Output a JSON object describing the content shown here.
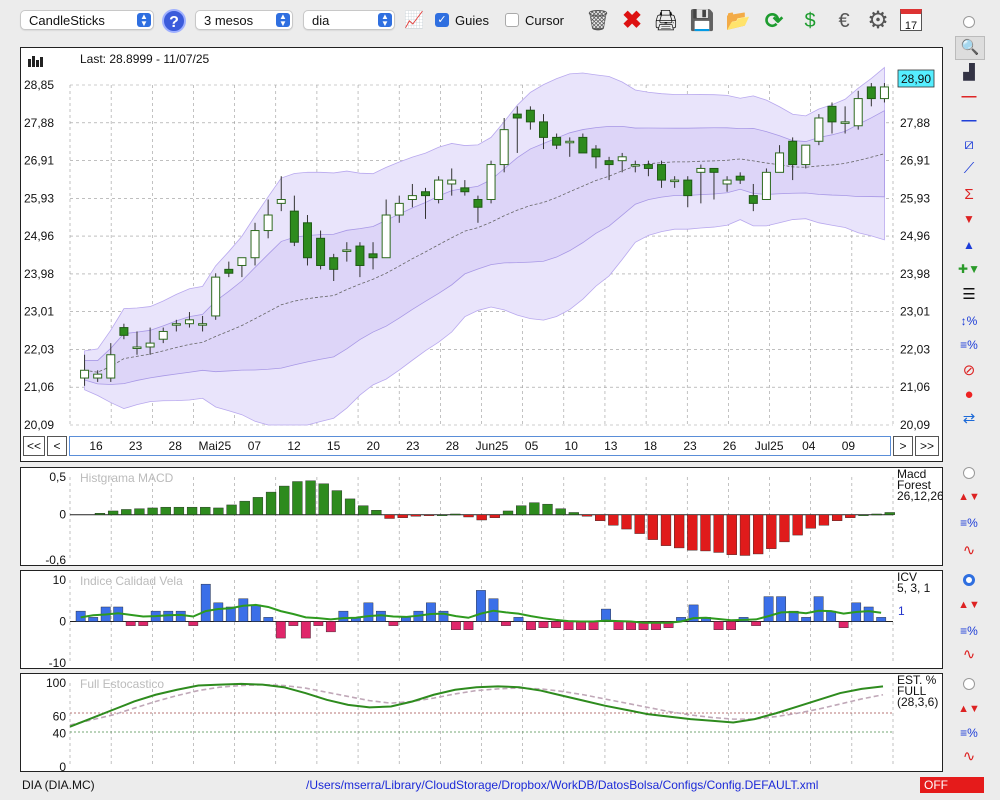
{
  "toolbar": {
    "chart_type": "CandleSticks",
    "period": "3 mesos",
    "interval": "dia",
    "guides_label": "Guies",
    "cursor_label": "Cursor",
    "guides_checked": true,
    "cursor_checked": false,
    "calendar_day": "17"
  },
  "price_panel": {
    "last": "Last: 28.8999 - 11/07/25",
    "y_labels": [
      "28,85",
      "27,88",
      "26,91",
      "25,93",
      "24,96",
      "23,98",
      "23,01",
      "22,03",
      "21,06",
      "20,09"
    ],
    "right_labels": [
      "27,88",
      "26,91",
      "25,93",
      "24,96",
      "23,98",
      "23,01",
      "22,03",
      "21,06",
      "20,09"
    ],
    "current_price": "28,90",
    "current_price_color": "#55eeff"
  },
  "timeline": {
    "prev_fast": "<<",
    "prev": "<",
    "next": ">",
    "next_fast": ">>",
    "labels": [
      "16",
      "23",
      "28",
      "Mai25",
      "07",
      "12",
      "15",
      "20",
      "23",
      "28",
      "Jun25",
      "05",
      "10",
      "13",
      "18",
      "23",
      "26",
      "Jul25",
      "04",
      "09"
    ]
  },
  "macd_panel": {
    "title": "Histgrama MACD",
    "y_labels": [
      "0,5",
      "0",
      "-0,6"
    ],
    "legend": [
      "Macd",
      "Forest",
      "26,12,26"
    ]
  },
  "icv_panel": {
    "title": "Indice Calidad Vela",
    "y_labels": [
      "10",
      "0",
      "-10"
    ],
    "legend": [
      "ICV",
      "5, 3, 1"
    ],
    "value": "1"
  },
  "stoch_panel": {
    "title": "Full Estocastico",
    "y_labels": [
      "100",
      "60",
      "40",
      "0"
    ],
    "legend": [
      "EST. %",
      "FULL",
      "(28,3,6)"
    ]
  },
  "status": {
    "symbol": "DIA (DIA.MC)",
    "path": "/Users/mserra/Library/CloudStorage/Dropbox/WorkDB/DatosBolsa/Configs/Config.DEFAULT.xml",
    "mode": "OFF"
  },
  "colors": {
    "up": "#2e8b1e",
    "down": "#ffffff",
    "macd_pos": "#2e8b1e",
    "macd_neg": "#e01b1b",
    "icv_pos": "#3b6fe8",
    "icv_neg": "#e0266a",
    "band_fill": "#e6e0fa"
  },
  "chart_data": [
    {
      "type": "candlestick",
      "title": "",
      "ylim": [
        20.09,
        28.85
      ],
      "candles": [
        {
          "o": 21.3,
          "h": 21.9,
          "l": 21.1,
          "c": 21.5
        },
        {
          "o": 21.3,
          "h": 21.5,
          "l": 21.2,
          "c": 21.4
        },
        {
          "o": 21.3,
          "h": 22.2,
          "l": 21.2,
          "c": 21.9
        },
        {
          "o": 22.6,
          "h": 22.7,
          "l": 22.3,
          "c": 22.4
        },
        {
          "o": 22.1,
          "h": 22.5,
          "l": 21.9,
          "c": 22.1
        },
        {
          "o": 22.1,
          "h": 22.6,
          "l": 21.9,
          "c": 22.2
        },
        {
          "o": 22.3,
          "h": 22.6,
          "l": 22.2,
          "c": 22.5
        },
        {
          "o": 22.7,
          "h": 22.8,
          "l": 22.5,
          "c": 22.7
        },
        {
          "o": 22.7,
          "h": 23.0,
          "l": 22.6,
          "c": 22.8
        },
        {
          "o": 22.7,
          "h": 22.9,
          "l": 22.5,
          "c": 22.7
        },
        {
          "o": 22.9,
          "h": 24.0,
          "l": 22.8,
          "c": 23.9
        },
        {
          "o": 24.1,
          "h": 24.3,
          "l": 23.9,
          "c": 24.0
        },
        {
          "o": 24.2,
          "h": 24.4,
          "l": 23.9,
          "c": 24.4
        },
        {
          "o": 24.4,
          "h": 25.3,
          "l": 24.2,
          "c": 25.1
        },
        {
          "o": 25.1,
          "h": 25.9,
          "l": 24.9,
          "c": 25.5
        },
        {
          "o": 25.8,
          "h": 26.5,
          "l": 25.6,
          "c": 25.9
        },
        {
          "o": 25.6,
          "h": 26.0,
          "l": 24.7,
          "c": 24.8
        },
        {
          "o": 25.3,
          "h": 25.5,
          "l": 24.2,
          "c": 24.4
        },
        {
          "o": 24.9,
          "h": 25.1,
          "l": 24.1,
          "c": 24.2
        },
        {
          "o": 24.4,
          "h": 24.5,
          "l": 23.8,
          "c": 24.1
        },
        {
          "o": 24.6,
          "h": 24.8,
          "l": 24.3,
          "c": 24.6
        },
        {
          "o": 24.7,
          "h": 24.8,
          "l": 23.9,
          "c": 24.2
        },
        {
          "o": 24.5,
          "h": 24.8,
          "l": 24.1,
          "c": 24.4
        },
        {
          "o": 24.4,
          "h": 25.9,
          "l": 24.4,
          "c": 25.5
        },
        {
          "o": 25.5,
          "h": 26.0,
          "l": 25.3,
          "c": 25.8
        },
        {
          "o": 25.9,
          "h": 26.3,
          "l": 25.7,
          "c": 26.0
        },
        {
          "o": 26.1,
          "h": 26.2,
          "l": 25.4,
          "c": 26.0
        },
        {
          "o": 25.9,
          "h": 26.5,
          "l": 25.8,
          "c": 26.4
        },
        {
          "o": 26.3,
          "h": 26.7,
          "l": 26.0,
          "c": 26.4
        },
        {
          "o": 26.2,
          "h": 26.4,
          "l": 26.0,
          "c": 26.1
        },
        {
          "o": 25.9,
          "h": 26.0,
          "l": 25.3,
          "c": 25.7
        },
        {
          "o": 25.9,
          "h": 26.9,
          "l": 25.8,
          "c": 26.8
        },
        {
          "o": 26.8,
          "h": 28.0,
          "l": 26.6,
          "c": 27.7
        },
        {
          "o": 28.1,
          "h": 28.3,
          "l": 27.1,
          "c": 28.0
        },
        {
          "o": 28.2,
          "h": 28.3,
          "l": 27.7,
          "c": 27.9
        },
        {
          "o": 27.9,
          "h": 28.1,
          "l": 27.2,
          "c": 27.5
        },
        {
          "o": 27.5,
          "h": 27.6,
          "l": 27.2,
          "c": 27.3
        },
        {
          "o": 27.4,
          "h": 27.5,
          "l": 27.0,
          "c": 27.4
        },
        {
          "o": 27.5,
          "h": 27.6,
          "l": 27.1,
          "c": 27.1
        },
        {
          "o": 27.2,
          "h": 27.3,
          "l": 26.7,
          "c": 27.0
        },
        {
          "o": 26.9,
          "h": 27.0,
          "l": 26.4,
          "c": 26.8
        },
        {
          "o": 26.9,
          "h": 27.1,
          "l": 26.6,
          "c": 27.0
        },
        {
          "o": 26.8,
          "h": 26.9,
          "l": 26.6,
          "c": 26.8
        },
        {
          "o": 26.8,
          "h": 26.9,
          "l": 26.5,
          "c": 26.7
        },
        {
          "o": 26.8,
          "h": 26.9,
          "l": 26.2,
          "c": 26.4
        },
        {
          "o": 26.4,
          "h": 26.5,
          "l": 26.2,
          "c": 26.4
        },
        {
          "o": 26.4,
          "h": 26.5,
          "l": 25.7,
          "c": 26.0
        },
        {
          "o": 26.6,
          "h": 26.8,
          "l": 25.8,
          "c": 26.7
        },
        {
          "o": 26.7,
          "h": 26.7,
          "l": 25.9,
          "c": 26.6
        },
        {
          "o": 26.3,
          "h": 26.5,
          "l": 26.1,
          "c": 26.4
        },
        {
          "o": 26.5,
          "h": 26.6,
          "l": 26.3,
          "c": 26.4
        },
        {
          "o": 26.0,
          "h": 26.3,
          "l": 25.6,
          "c": 25.8
        },
        {
          "o": 25.9,
          "h": 26.7,
          "l": 25.9,
          "c": 26.6
        },
        {
          "o": 26.6,
          "h": 27.3,
          "l": 26.6,
          "c": 27.1
        },
        {
          "o": 27.4,
          "h": 27.5,
          "l": 26.4,
          "c": 26.8
        },
        {
          "o": 26.8,
          "h": 27.3,
          "l": 26.7,
          "c": 27.3
        },
        {
          "o": 27.4,
          "h": 28.1,
          "l": 27.3,
          "c": 28.0
        },
        {
          "o": 28.3,
          "h": 28.4,
          "l": 27.6,
          "c": 27.9
        },
        {
          "o": 27.9,
          "h": 28.3,
          "l": 27.6,
          "c": 27.9
        },
        {
          "o": 27.8,
          "h": 28.7,
          "l": 27.7,
          "c": 28.5
        },
        {
          "o": 28.8,
          "h": 28.9,
          "l": 28.3,
          "c": 28.5
        },
        {
          "o": 28.5,
          "h": 28.9,
          "l": 28.4,
          "c": 28.8
        }
      ]
    },
    {
      "type": "bar",
      "title": "Histgrama MACD",
      "ylim": [
        -0.6,
        0.5
      ],
      "values": [
        0.02,
        0.05,
        0.07,
        0.08,
        0.09,
        0.1,
        0.1,
        0.1,
        0.1,
        0.09,
        0.13,
        0.18,
        0.23,
        0.3,
        0.38,
        0.44,
        0.45,
        0.41,
        0.32,
        0.21,
        0.12,
        0.06,
        -0.05,
        -0.04,
        -0.02,
        -0.01,
        0.0,
        0.01,
        -0.03,
        -0.07,
        -0.04,
        0.05,
        0.12,
        0.16,
        0.14,
        0.08,
        0.03,
        -0.02,
        -0.08,
        -0.14,
        -0.19,
        -0.25,
        -0.33,
        -0.41,
        -0.44,
        -0.47,
        -0.48,
        -0.5,
        -0.53,
        -0.54,
        -0.52,
        -0.45,
        -0.36,
        -0.27,
        -0.18,
        -0.14,
        -0.08,
        -0.04,
        0.0,
        0.01,
        0.03
      ]
    },
    {
      "type": "bar",
      "title": "Indice Calidad Vela",
      "ylim": [
        -10,
        10
      ],
      "values": [
        2.5,
        1,
        3.5,
        3.5,
        -1,
        -1,
        2.5,
        2.5,
        2.5,
        -1,
        9,
        4.5,
        3.5,
        5.5,
        4,
        1,
        -4,
        -1,
        -4,
        -1,
        -2.5,
        2.5,
        1,
        4.5,
        2.5,
        -1,
        1,
        2.5,
        4.5,
        2.5,
        -2,
        -2,
        7.5,
        5.5,
        -1,
        1,
        -2,
        -1.5,
        -1.5,
        -2,
        -2,
        -2,
        3,
        -2,
        -2,
        -2,
        -2,
        -1.5,
        1,
        4,
        1,
        -2,
        -2,
        1,
        -1,
        6,
        6,
        2.5,
        1,
        6,
        2.5,
        -1.5,
        4.5,
        3.5,
        1
      ],
      "signal": [
        1,
        1.5,
        1.7,
        2,
        1.6,
        1.2,
        1.3,
        1.5,
        1.6,
        1.2,
        2.5,
        3,
        3.2,
        3.8,
        4,
        3.5,
        2.5,
        1.8,
        1,
        0.8,
        0.5,
        0.8,
        0.9,
        1.3,
        1.5,
        1.2,
        1.1,
        1.4,
        1.8,
        1.9,
        1.3,
        0.9,
        1.9,
        2.6,
        2.2,
        1.9,
        1.3,
        0.8,
        0.4,
        0.1,
        0,
        0,
        0.2,
        0.1,
        0,
        -0.3,
        -0.3,
        -0.3,
        0,
        0.8,
        0.9,
        0.6,
        0.3,
        0.4,
        0.5,
        1.3,
        2.2,
        2.3,
        2,
        2.6,
        2.5,
        1.9,
        2.3,
        2.5,
        2.1
      ]
    },
    {
      "type": "line",
      "title": "Full Estocastico",
      "ylim": [
        0,
        100
      ],
      "series": [
        {
          "values": [
            48,
            58,
            68,
            78,
            86,
            92,
            97,
            98,
            99,
            98,
            95,
            88,
            80,
            74,
            71,
            72,
            78,
            86,
            92,
            95,
            96,
            95,
            91,
            85,
            79,
            73,
            68,
            63,
            60,
            57,
            55,
            53,
            57,
            64,
            72,
            80,
            88,
            93,
            96
          ]
        },
        {
          "values": [
            50,
            56,
            62,
            70,
            78,
            85,
            91,
            95,
            97,
            98,
            97,
            94,
            89,
            84,
            79,
            76,
            78,
            82,
            87,
            91,
            93,
            94,
            93,
            90,
            86,
            81,
            76,
            71,
            66,
            62,
            59,
            57,
            57,
            60,
            64,
            69,
            75,
            81,
            86
          ]
        }
      ]
    }
  ]
}
